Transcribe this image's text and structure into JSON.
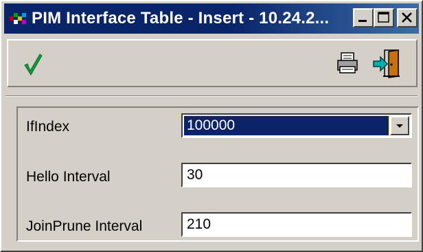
{
  "window": {
    "title": "PIM Interface Table - Insert - 10.24.2..."
  },
  "toolbar": {
    "apply_icon": "checkmark-icon",
    "print_icon": "printer-icon",
    "exit_icon": "exit-door-icon"
  },
  "form": {
    "ifindex": {
      "label": "IfIndex",
      "value": "100000"
    },
    "hello_interval": {
      "label": "Hello Interval",
      "value": "30"
    },
    "joinprune_interval": {
      "label": "JoinPrune Interval",
      "value": "210"
    }
  },
  "colors": {
    "titlebar": "#0a246a",
    "face": "#d4d0c8",
    "check": "#0f9b3a",
    "selection": "#0a246a"
  }
}
